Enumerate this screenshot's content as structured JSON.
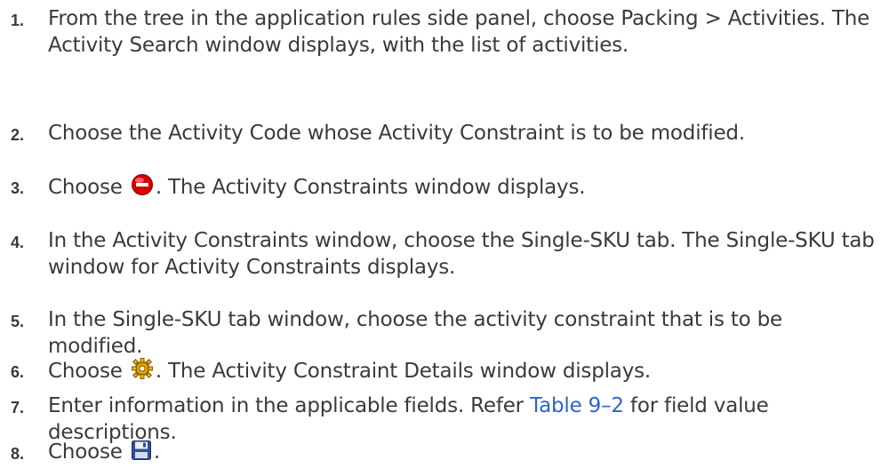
{
  "steps": [
    {
      "number": "1.",
      "text": "From the tree in the application rules side panel, choose Packing > Activities. The Activity Search window displays, with the list of activities."
    },
    {
      "number": "2.",
      "text": "Choose the Activity Code whose Activity Constraint is to be modified."
    },
    {
      "number": "3.",
      "before": "Choose ",
      "icon": "delete-icon",
      "after": ". The Activity Constraints window displays."
    },
    {
      "number": "4.",
      "text": "In the Activity Constraints window, choose the Single-SKU tab. The Single-SKU tab window for Activity Constraints displays."
    },
    {
      "number": "5.",
      "text": "In the Single-SKU tab window, choose the activity constraint that is to be modified."
    },
    {
      "number": "6.",
      "before": "Choose ",
      "icon": "gear-icon",
      "after": ". The Activity Constraint Details window displays."
    },
    {
      "number": "7.",
      "before": "Enter information in the applicable fields. Refer ",
      "link": "Table 9–2",
      "after": " for field value descriptions."
    },
    {
      "number": "8.",
      "before": "Choose ",
      "icon": "save-icon",
      "after": "."
    }
  ],
  "colors": {
    "text": "#3a3a3a",
    "link": "#2a66c8",
    "delete_icon": "#d40000",
    "gear_icon": "#e0a000",
    "save_icon": "#2f4f9a"
  }
}
